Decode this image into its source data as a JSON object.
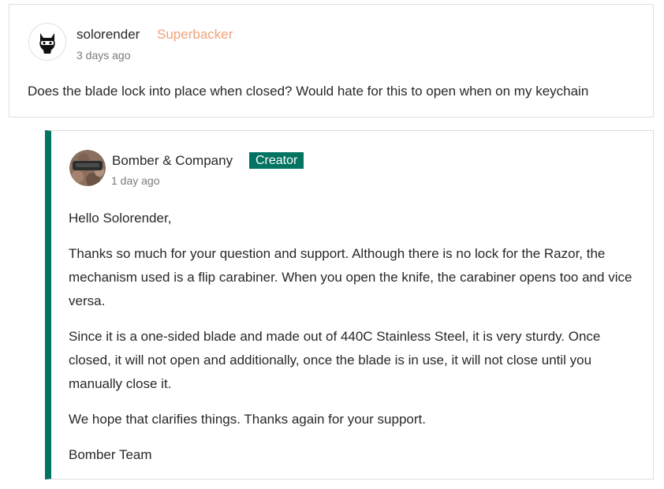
{
  "comment": {
    "author": "solorender",
    "badge": "Superbacker",
    "time": "3 days ago",
    "body": "Does the blade lock into place when closed? Would hate for this to open when on my keychain",
    "avatar_icon": "ninja-mask-icon"
  },
  "reply": {
    "author": "Bomber & Company",
    "badge": "Creator",
    "time": "1 day ago",
    "avatar_icon": "company-photo-avatar",
    "paragraphs": [
      "Hello Solorender,",
      "Thanks so much for your question and support. Although there is no lock for the Razor, the mechanism used is a flip carabiner. When you open the knife, the carabiner opens too and vice versa.",
      "Since it is a one-sided blade and made out of 440C Stainless Steel, it is very sturdy. Once closed, it will not open and additionally, once the blade is in use, it will not close until you manually close it.",
      "We hope that clarifies things. Thanks again for your support.",
      "Bomber Team"
    ]
  },
  "colors": {
    "accent": "#037362",
    "superbacker": "#f0a178",
    "border": "#dcdedd",
    "muted_text": "#7a7a7a"
  }
}
